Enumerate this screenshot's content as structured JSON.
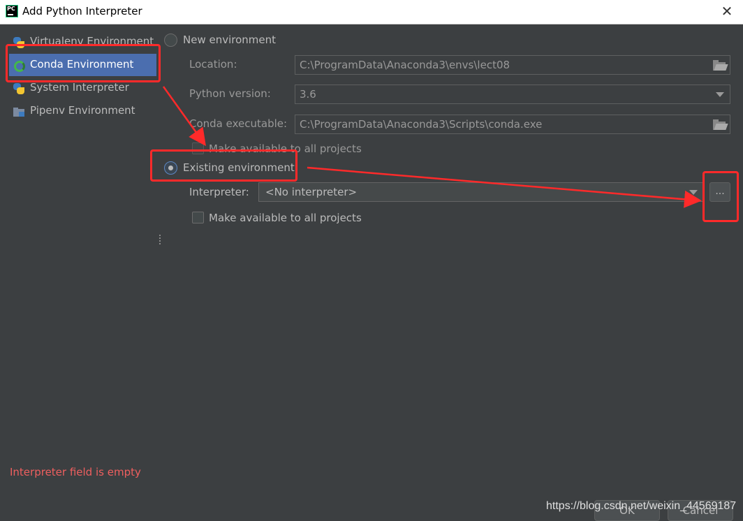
{
  "window": {
    "title": "Add Python Interpreter"
  },
  "sidebar": {
    "items": [
      {
        "label": "Virtualenv Environment",
        "icon": "python-icon"
      },
      {
        "label": "Conda Environment",
        "icon": "conda-icon",
        "selected": true
      },
      {
        "label": "System Interpreter",
        "icon": "python-icon"
      },
      {
        "label": "Pipenv Environment",
        "icon": "pipenv-folder-icon"
      }
    ]
  },
  "new_env": {
    "label": "New environment",
    "location_label": "Location:",
    "location_value": "C:\\ProgramData\\Anaconda3\\envs\\lect08",
    "python_version_label": "Python version:",
    "python_version_value": "3.6",
    "conda_exec_label": "Conda executable:",
    "conda_exec_value": "C:\\ProgramData\\Anaconda3\\Scripts\\conda.exe",
    "make_available_label": "Make available to all projects"
  },
  "existing_env": {
    "label": "Existing environment",
    "interpreter_label": "Interpreter:",
    "interpreter_value": "<No interpreter>",
    "browse_label": "...",
    "make_available_label": "Make available to all projects"
  },
  "error_message": "Interpreter field is empty",
  "footer": {
    "ok_label": "OK",
    "cancel_label": "Cancel"
  },
  "watermark": "https://blog.csdn.net/weixin_44569187",
  "colors": {
    "background": "#3c3f41",
    "selection": "#4b6eaf",
    "error": "#ef5f5f",
    "annotation": "#ff2a2a"
  }
}
